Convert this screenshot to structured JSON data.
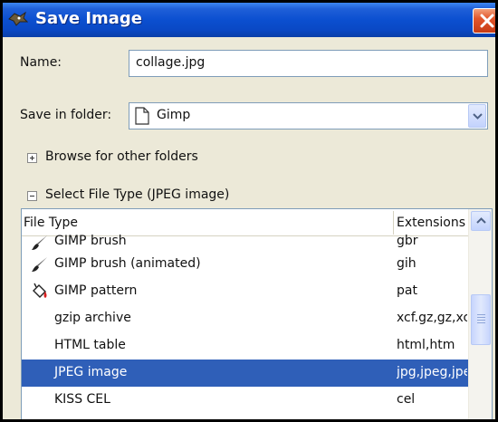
{
  "window": {
    "title": "Save Image"
  },
  "form": {
    "name_label": "Name:",
    "name_value": "collage.jpg",
    "folder_label": "Save in folder:",
    "folder_value": "Gimp",
    "browse_label": "Browse for other folders",
    "file_type_label": "Select File Type (JPEG image)"
  },
  "file_list": {
    "columns": [
      "File Type",
      "Extensions"
    ],
    "rows": [
      {
        "name": "GIMP brush",
        "ext": "gbr",
        "icon": "paintbrush-icon"
      },
      {
        "name": "GIMP brush (animated)",
        "ext": "gih",
        "icon": "paintbrush-icon"
      },
      {
        "name": "GIMP pattern",
        "ext": "pat",
        "icon": "bucket-fill-icon"
      },
      {
        "name": "gzip archive",
        "ext": "xcf.gz,gz,xcfgz",
        "icon": ""
      },
      {
        "name": "HTML table",
        "ext": "html,htm",
        "icon": ""
      },
      {
        "name": "JPEG image",
        "ext": "jpg,jpeg,jpe",
        "icon": "",
        "selected": true
      },
      {
        "name": "KISS CEL",
        "ext": "cel",
        "icon": ""
      }
    ]
  },
  "colors": {
    "titlebar": "#0b4fd0",
    "selection": "#2f5fb8",
    "close_button": "#e2562c"
  }
}
